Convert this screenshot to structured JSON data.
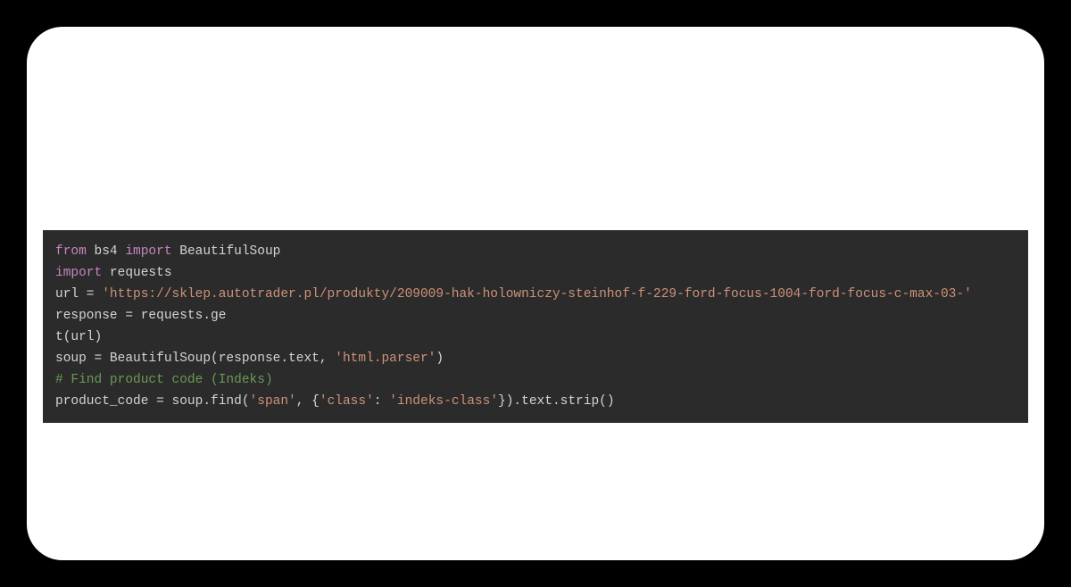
{
  "code": {
    "line1": {
      "kw_from": "from",
      "mod1": " bs4 ",
      "kw_import": "import",
      "mod2": " BeautifulSoup"
    },
    "line2": {
      "kw_import": "import",
      "mod": " requests"
    },
    "line3": {
      "pre": "url = ",
      "str": "'https://sklep.autotrader.pl/produkty/209009-hak-holowniczy-steinhof-f-229-ford-focus-1004-ford-focus-c-max-03-'"
    },
    "line4": {
      "text": "response = requests.ge"
    },
    "line5": {
      "text": "t(url)"
    },
    "line6": {
      "pre": "soup = BeautifulSoup(response.text, ",
      "str": "'html.parser'",
      "post": ")"
    },
    "line7": {
      "comment": "# Find product code (Indeks)"
    },
    "line8": {
      "pre": "product_code = soup.find(",
      "str1": "'span'",
      "mid1": ", {",
      "str2": "'class'",
      "mid2": ": ",
      "str3": "'indeks-class'",
      "post": "}).text.strip()"
    }
  }
}
